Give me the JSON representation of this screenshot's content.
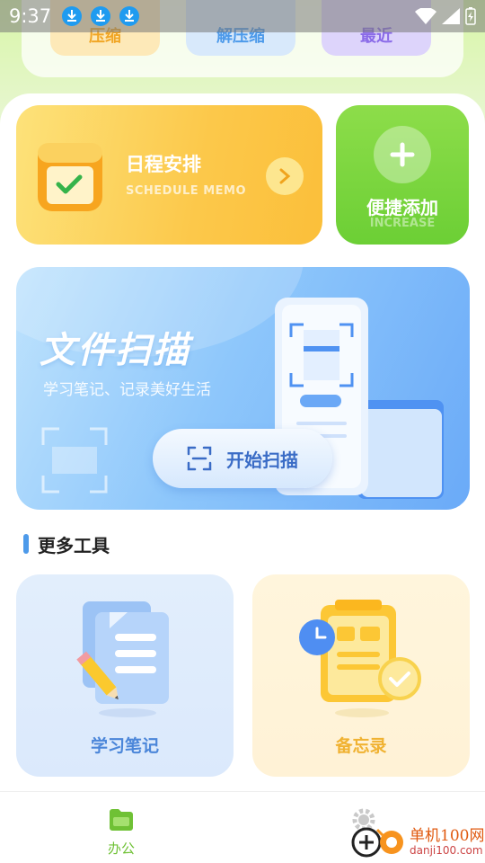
{
  "status": {
    "time": "9:37"
  },
  "top_tabs": [
    {
      "label": "压缩"
    },
    {
      "label": "解压缩"
    },
    {
      "label": "最近"
    }
  ],
  "schedule": {
    "title": "日程安排",
    "subtitle": "SCHEDULE MEMO"
  },
  "quick_add": {
    "title": "便捷添加",
    "subtitle": "INCREASE"
  },
  "scan": {
    "title": "文件扫描",
    "subtitle": "学习笔记、记录美好生活",
    "button_label": "开始扫描"
  },
  "more_tools": {
    "title": "更多工具",
    "items": [
      {
        "label": "学习笔记"
      },
      {
        "label": "备忘录"
      }
    ]
  },
  "bottom_nav": {
    "office_label": "办公"
  },
  "watermark": {
    "name": "单机100网",
    "url": "danji100.com"
  },
  "colors": {
    "accent_green": "#6fc135",
    "accent_blue": "#4d9aea",
    "accent_yellow": "#f0b232"
  }
}
